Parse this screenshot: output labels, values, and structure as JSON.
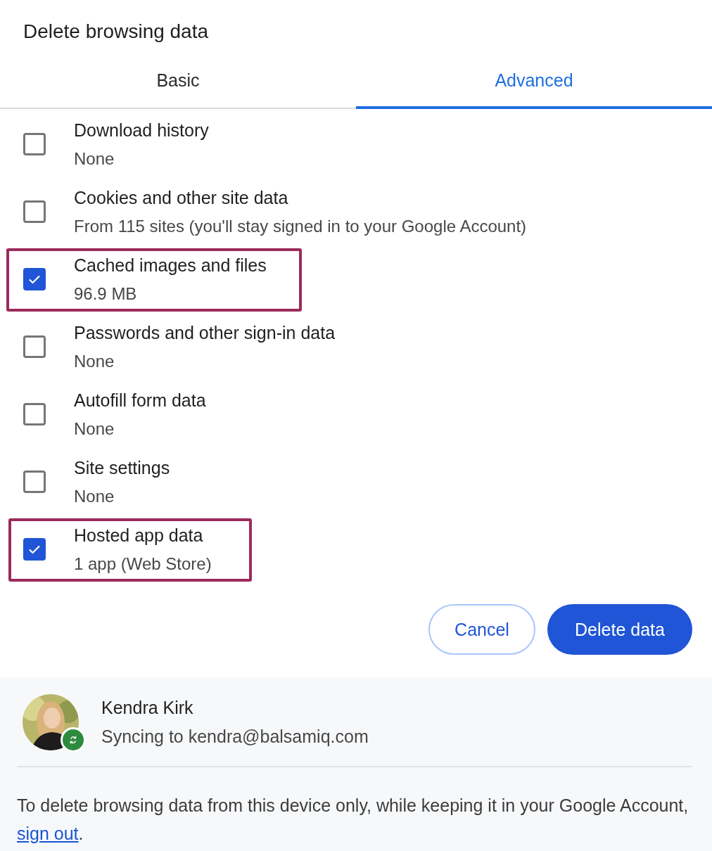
{
  "dialog": {
    "title": "Delete browsing data"
  },
  "tabs": [
    {
      "label": "Basic",
      "selected": false
    },
    {
      "label": "Advanced",
      "selected": true
    }
  ],
  "items": [
    {
      "label": "Download history",
      "detail": "None",
      "checked": false,
      "highlighted": false
    },
    {
      "label": "Cookies and other site data",
      "detail": "From 115 sites (you'll stay signed in to your Google Account)",
      "checked": false,
      "highlighted": false
    },
    {
      "label": "Cached images and files",
      "detail": "96.9 MB",
      "checked": true,
      "highlighted": true
    },
    {
      "label": "Passwords and other sign-in data",
      "detail": "None",
      "checked": false,
      "highlighted": false
    },
    {
      "label": "Autofill form data",
      "detail": "None",
      "checked": false,
      "highlighted": false
    },
    {
      "label": "Site settings",
      "detail": "None",
      "checked": false,
      "highlighted": false
    },
    {
      "label": "Hosted app data",
      "detail": "1 app (Web Store)",
      "checked": true,
      "highlighted": true
    }
  ],
  "buttons": [
    {
      "label": "Cancel",
      "kind": "secondary"
    },
    {
      "label": "Delete data",
      "kind": "primary"
    }
  ],
  "account": {
    "name": "Kendra Kirk",
    "status": "Syncing to kendra@balsamiq.com",
    "syncing": true
  },
  "footer_note": {
    "text": "To delete browsing data from this device only, while keeping it in your Google Account,",
    "link": "sign out",
    "end": "."
  }
}
